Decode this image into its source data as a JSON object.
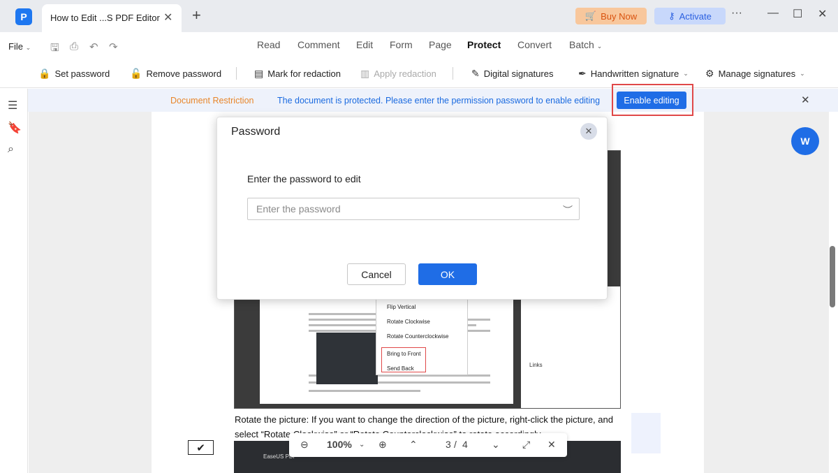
{
  "titlebar": {
    "tab_title": "How to Edit ...S PDF Editor",
    "tab_close": "✕",
    "new_tab": "+",
    "buy_now": "Buy Now",
    "activate": "Activate",
    "more": "···",
    "minimize": "—",
    "maximize": "☐",
    "close": "✕"
  },
  "menubar": {
    "file": "File",
    "items": [
      "Read",
      "Comment",
      "Edit",
      "Form",
      "Page",
      "Protect",
      "Convert",
      "Batch"
    ],
    "active": "Protect"
  },
  "toolbar": {
    "set_password": "Set password",
    "remove_password": "Remove password",
    "mark_for_redaction": "Mark for redaction",
    "apply_redaction": "Apply redaction",
    "digital_signatures": "Digital signatures",
    "handwritten_signature": "Handwritten signature",
    "manage_signatures": "Manage signatures"
  },
  "restriction": {
    "label": "Document Restriction",
    "message": "The document is protected. Please enter the permission password to enable editing",
    "enable_button": "Enable editing"
  },
  "document": {
    "context_menu": [
      "Flip Vertical",
      "Rotate Clockwise",
      "Rotate Counterclockwise",
      "Bring to Front",
      "Send Back"
    ],
    "props_links": "Links",
    "paragraph_1": "Rotate the picture: If you want to change the direction of the picture, right-click the picture, and",
    "paragraph_2": "select “Rotate Clockwise” or “Rotate Counterclockwise” to rotate accordingly.",
    "doc2_app": "EaseUS PDF",
    "checkbox_mark": "✔",
    "word_badge": "W"
  },
  "zoombar": {
    "zoom": "100%",
    "page": "3",
    "total": "4"
  },
  "dialog": {
    "title": "Password",
    "label": "Enter the password to edit",
    "placeholder": "Enter the password",
    "value": "",
    "cancel": "Cancel",
    "ok": "OK"
  },
  "colors": {
    "accent": "#1f6de6",
    "highlight": "#e04848",
    "warning": "#e8862a"
  }
}
